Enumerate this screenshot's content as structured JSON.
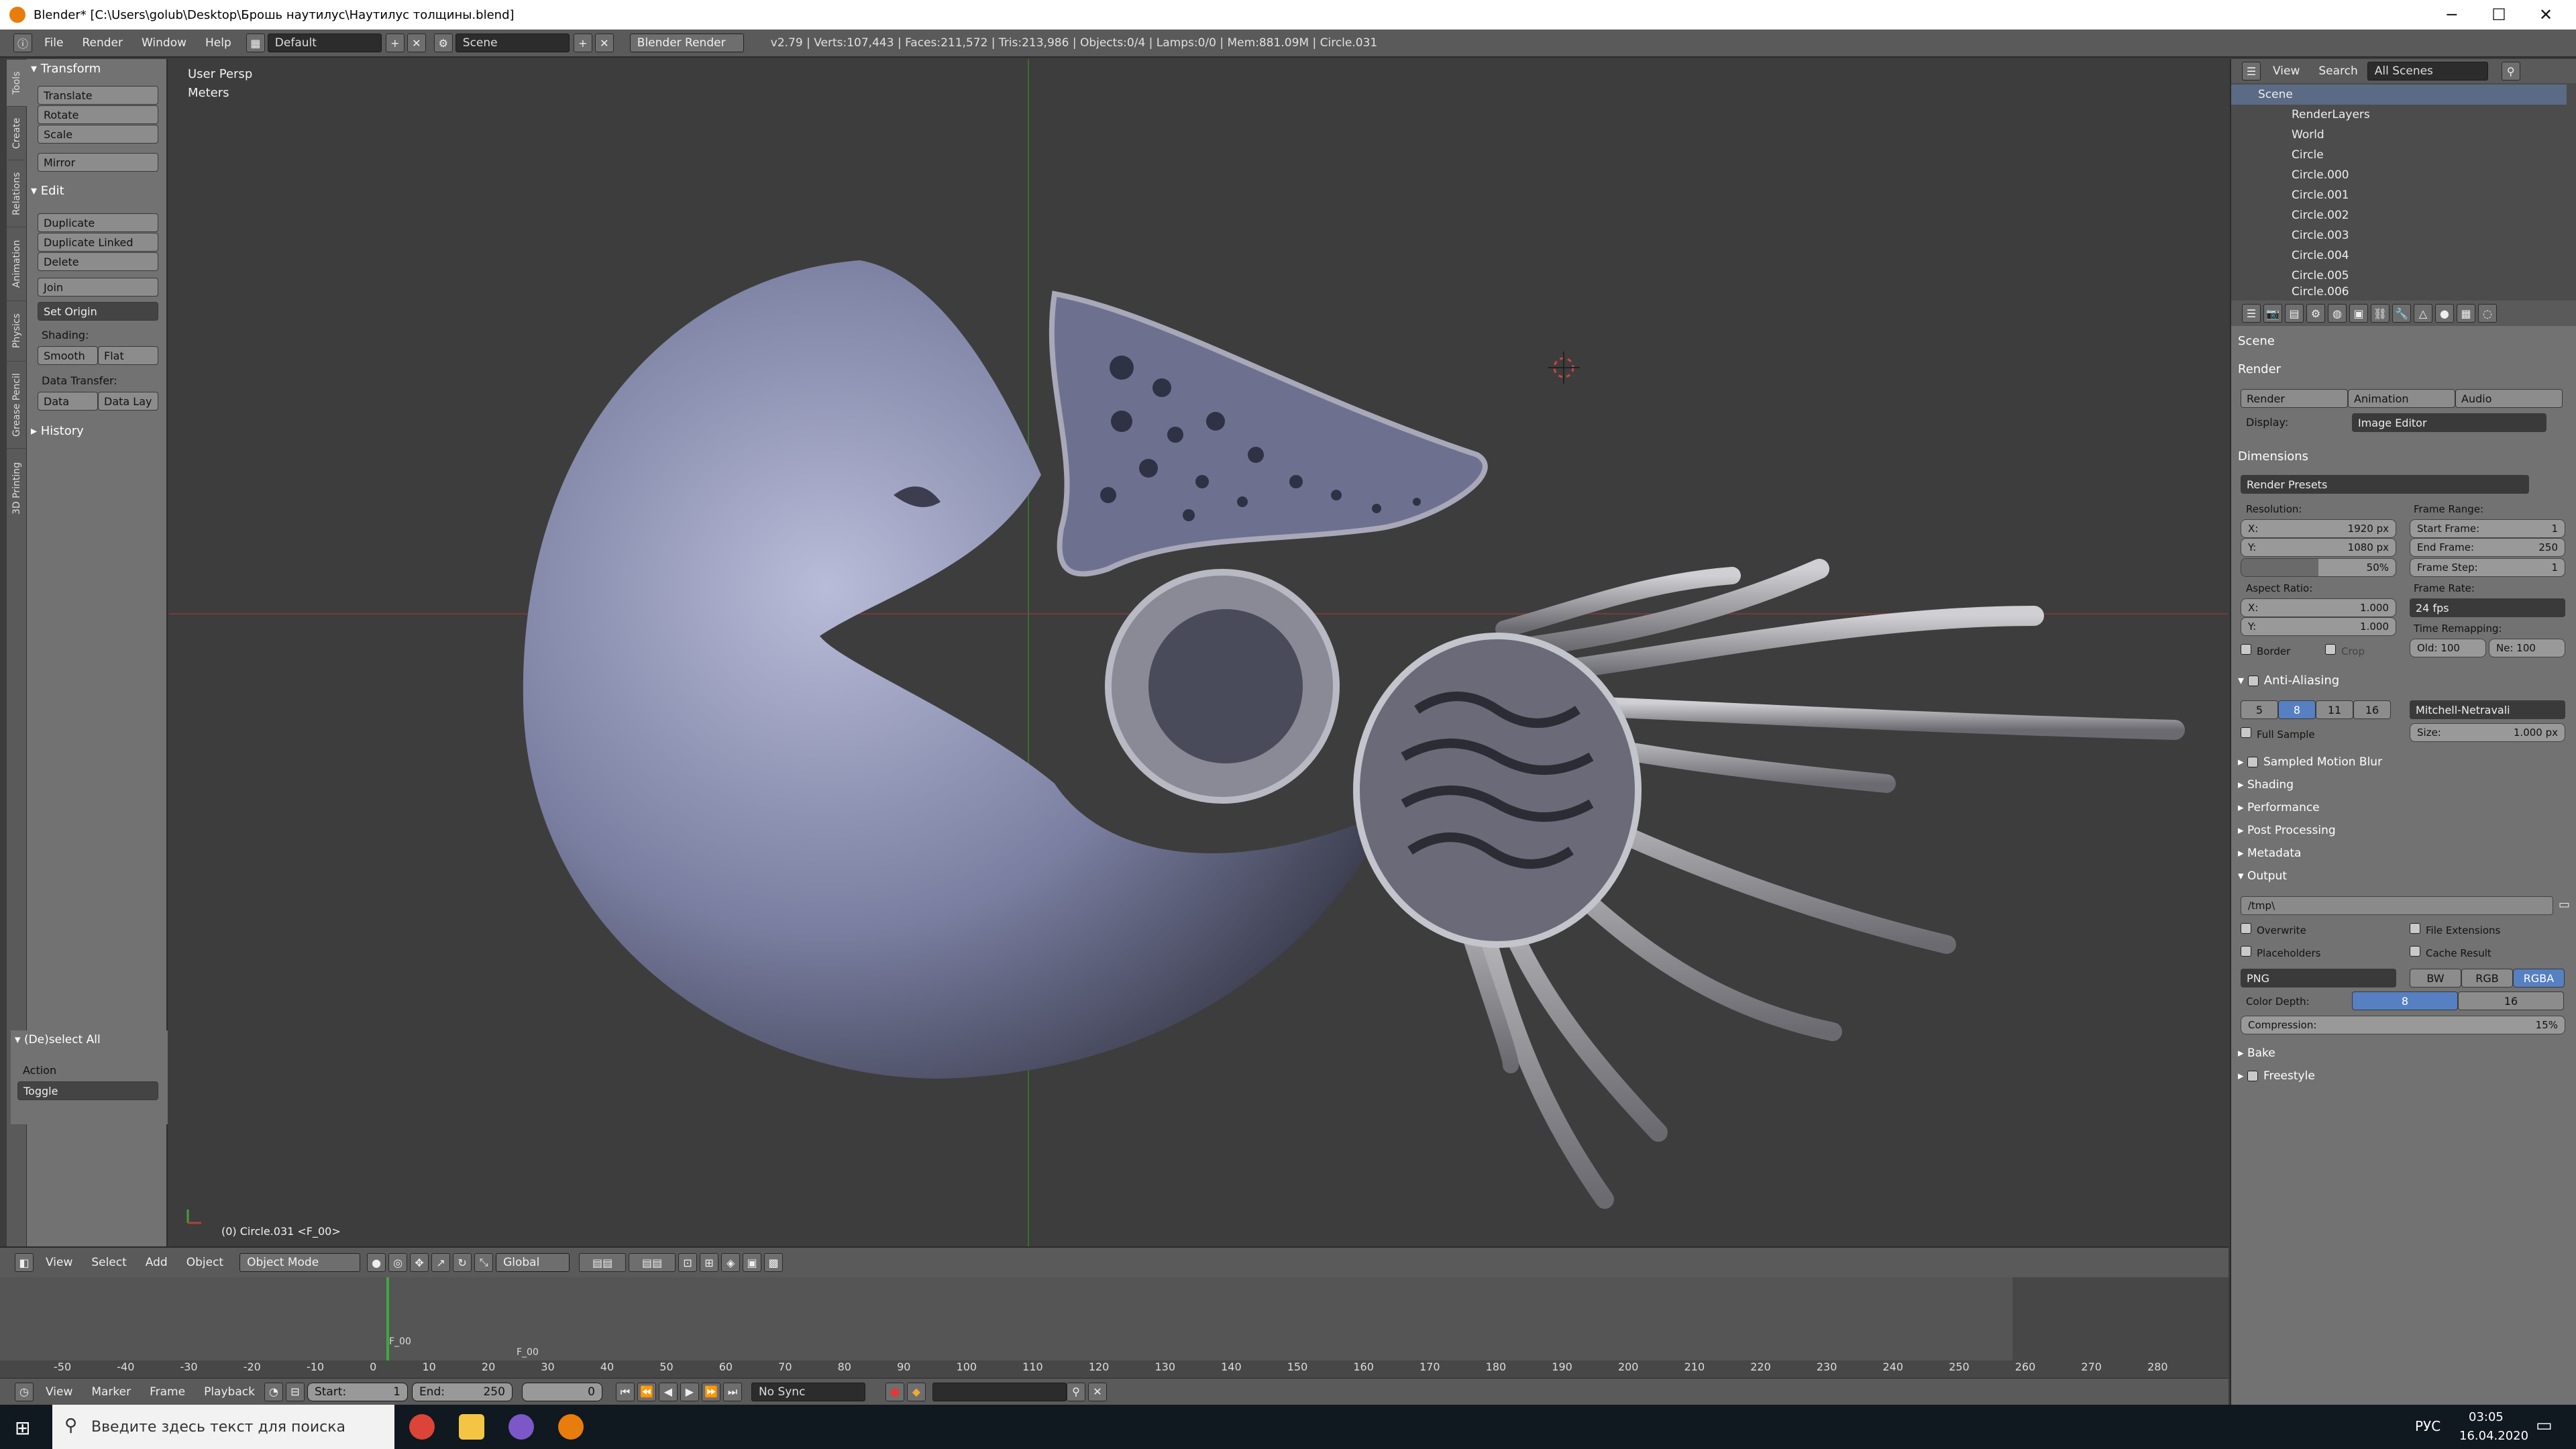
{
  "window": {
    "title": "Blender* [C:\\Users\\golub\\Desktop\\Брошь наутилус\\Наутилус толщины.blend]",
    "min": "─",
    "max": "☐",
    "close": "✕"
  },
  "infobar": {
    "menus": [
      "File",
      "Render",
      "Window",
      "Help"
    ],
    "layout": "Default",
    "scene": "Scene",
    "engine": "Blender Render",
    "stats": "v2.79 | Verts:107,443 | Faces:211,572 | Tris:213,986 | Objects:0/4 | Lamps:0/0 | Mem:881.09M | Circle.031"
  },
  "tool_tabs": [
    "Tools",
    "Create",
    "Relations",
    "Animation",
    "Physics",
    "Grease Pencil",
    "3D Printing"
  ],
  "shelf": {
    "transform_title": "Transform",
    "transform": [
      "Translate",
      "Rotate",
      "Scale",
      "Mirror"
    ],
    "edit_title": "Edit",
    "edit": [
      "Duplicate",
      "Duplicate Linked",
      "Delete",
      "Join"
    ],
    "set_origin": "Set Origin",
    "shading_label": "Shading:",
    "smooth": "Smooth",
    "flat": "Flat",
    "data_transfer_label": "Data Transfer:",
    "data": "Data",
    "data_lay": "Data Lay",
    "history": "History",
    "operator_title": "(De)select All",
    "action_label": "Action",
    "action_value": "Toggle"
  },
  "viewport": {
    "persp": "User Persp",
    "units": "Meters",
    "object_info": "(0) Circle.031 <F_00>"
  },
  "view_header": {
    "menus": [
      "View",
      "Select",
      "Add",
      "Object"
    ],
    "mode": "Object Mode",
    "orientation": "Global"
  },
  "timeline": {
    "ticks": [
      "-50",
      "-40",
      "-30",
      "-20",
      "-10",
      "0",
      "10",
      "20",
      "30",
      "40",
      "50",
      "60",
      "70",
      "80",
      "90",
      "100",
      "110",
      "120",
      "130",
      "140",
      "150",
      "160",
      "170",
      "180",
      "190",
      "200",
      "210",
      "220",
      "230",
      "240",
      "250",
      "260",
      "270",
      "280"
    ],
    "marker1": "F_00",
    "marker2": "F_00",
    "menus": [
      "View",
      "Marker",
      "Frame",
      "Playback"
    ],
    "start_label": "Start:",
    "start": "1",
    "end_label": "End:",
    "end": "250",
    "current": "0",
    "sync": "No Sync"
  },
  "outliner": {
    "menus": [
      "View",
      "Search"
    ],
    "filter": "All Scenes",
    "items": [
      "Scene",
      "RenderLayers",
      "World",
      "Circle",
      "Circle.000",
      "Circle.001",
      "Circle.002",
      "Circle.003",
      "Circle.004",
      "Circle.005",
      "Circle.006"
    ]
  },
  "props": {
    "context": "Scene",
    "render": "Render",
    "render_btn": "Render",
    "animation_btn": "Animation",
    "audio_btn": "Audio",
    "display_label": "Display:",
    "display_value": "Image Editor",
    "dimensions": "Dimensions",
    "presets": "Render Presets",
    "resolution": "Resolution:",
    "res_x_label": "X:",
    "res_x": "1920 px",
    "res_y_label": "Y:",
    "res_y": "1080 px",
    "res_pct": "50%",
    "frame_range": "Frame Range:",
    "start_label": "Start Frame:",
    "start": "1",
    "end_label": "End Frame:",
    "end": "250",
    "step_label": "Frame Step:",
    "step": "1",
    "aspect": "Aspect Ratio:",
    "asp_x": "1.000",
    "asp_y": "1.000",
    "frame_rate": "Frame Rate:",
    "fps": "24 fps",
    "remap": "Time Remapping:",
    "old": "Old: 100",
    "new": "Ne: 100",
    "border": "Border",
    "crop": "Crop",
    "aa": "Anti-Aliasing",
    "aa_levels": [
      "5",
      "8",
      "11",
      "16"
    ],
    "aa_filter": "Mitchell-Netravali",
    "full_sample": "Full Sample",
    "size": "Size:",
    "size_value": "1.000 px",
    "panels": [
      "Sampled Motion Blur",
      "Shading",
      "Performance",
      "Post Processing",
      "Metadata"
    ],
    "output": "Output",
    "path": "/tmp\\",
    "overwrite": "Overwrite",
    "file_ext": "File Extensions",
    "placeholders": "Placeholders",
    "cache": "Cache Result",
    "format": "PNG",
    "bw": "BW",
    "rgb": "RGB",
    "rgba": "RGBA",
    "depth_label": "Color Depth:",
    "depth8": "8",
    "depth16": "16",
    "compression": "Compression:",
    "compression_value": "15%",
    "bake": "Bake",
    "freestyle": "Freestyle"
  },
  "taskbar": {
    "search": "Введите здесь текст для поиска",
    "lang": "РУС",
    "time": "03:05",
    "date": "16.04.2020"
  }
}
